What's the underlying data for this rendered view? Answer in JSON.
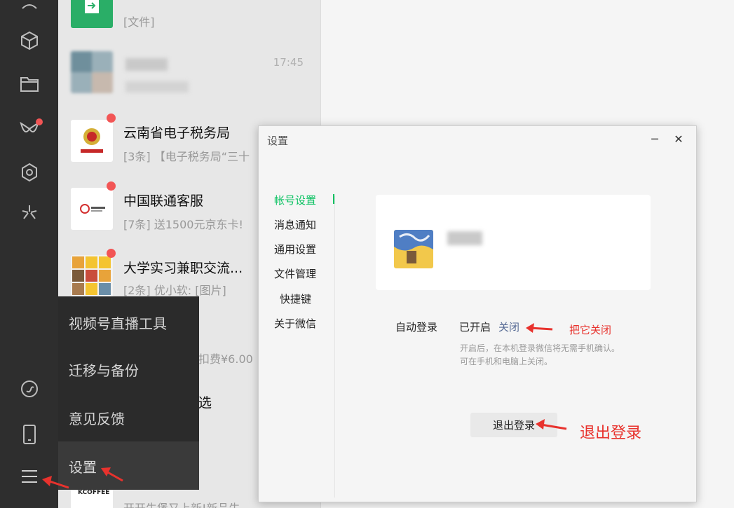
{
  "left_bar": {
    "icons": [
      "contacts-icon",
      "mini-program-icon",
      "folder-icon",
      "channels-icon",
      "moments-icon",
      "search-spark-icon",
      "link-icon",
      "phone-icon",
      "menu-icon"
    ]
  },
  "chat_list": {
    "items": [
      {
        "name": "",
        "message": "[文件]",
        "time": ""
      },
      {
        "name": "",
        "message": "",
        "time": "17:45"
      },
      {
        "name": "云南省电子税务局",
        "message": "[3条] 【电子税务局“三十",
        "time": ""
      },
      {
        "name": "中国联通客服",
        "message": "[7条] 送1500元京东卡!",
        "time": ""
      },
      {
        "name": "大学实习兼职交流...",
        "message": "[2条] 优小软: [图片]",
        "time": ""
      },
      {
        "name": "",
        "message": "扣费¥6.00",
        "time": ""
      },
      {
        "name": "选",
        "message": "",
        "time": ""
      },
      {
        "name": "",
        "message": "开开牛堡又上新!新品牛",
        "time": ""
      }
    ]
  },
  "popup_menu": {
    "items": [
      "视频号直播工具",
      "迁移与备份",
      "意见反馈",
      "设置"
    ]
  },
  "settings": {
    "title": "设置",
    "nav": [
      "帐号设置",
      "消息通知",
      "通用设置",
      "文件管理",
      "快捷键",
      "关于微信"
    ],
    "auto_login_label": "自动登录",
    "auto_login_status": "已开启",
    "close_link": "关闭",
    "hint_line1": "开启后，在本机登录微信将无需手机确认。",
    "hint_line2": "可在手机和电脑上关闭。",
    "logout_button": "退出登录",
    "minimize": "─",
    "close": "✕"
  },
  "annotations": {
    "close_it": "把它关闭",
    "logout": "退出登录"
  },
  "colors": {
    "accent_green": "#07c160",
    "link_blue": "#576b95",
    "annotation_red": "#e8322d",
    "unread_red": "#f25555"
  }
}
